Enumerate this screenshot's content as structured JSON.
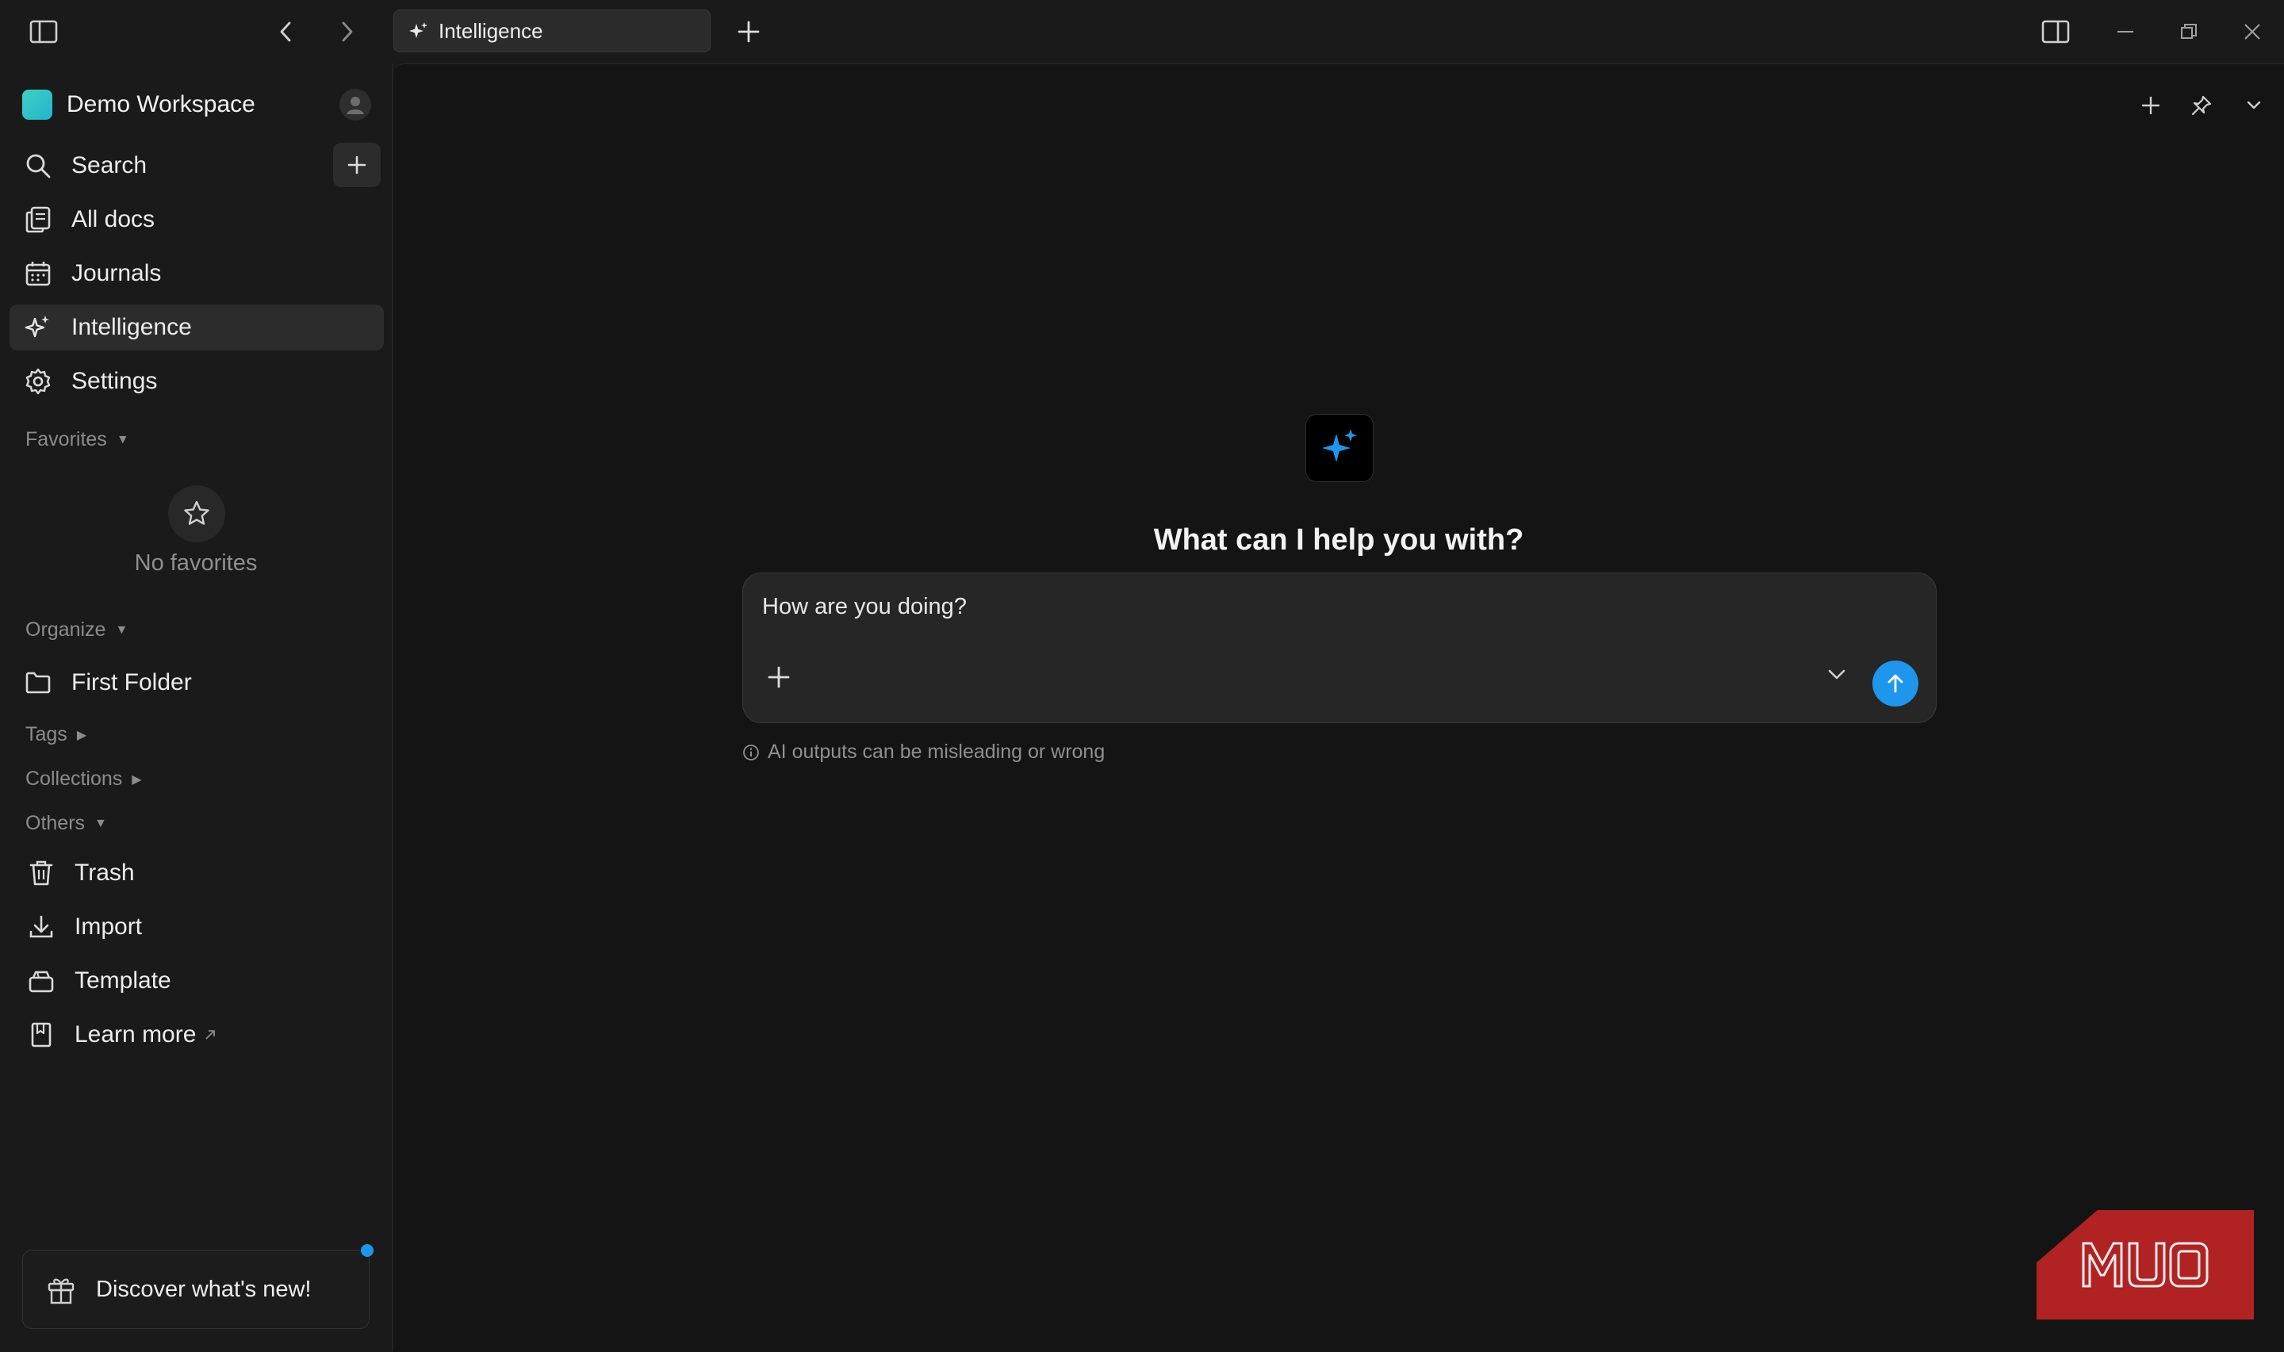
{
  "tab": {
    "label": "Intelligence"
  },
  "workspace": {
    "name": "Demo Workspace"
  },
  "sidebar": {
    "items": [
      {
        "label": "Search"
      },
      {
        "label": "All docs"
      },
      {
        "label": "Journals"
      },
      {
        "label": "Intelligence"
      },
      {
        "label": "Settings"
      }
    ],
    "favorites": {
      "header": "Favorites",
      "empty_text": "No favorites"
    },
    "organize": {
      "header": "Organize",
      "items": [
        {
          "label": "First Folder"
        }
      ]
    },
    "tags_header": "Tags",
    "collections_header": "Collections",
    "others": {
      "header": "Others",
      "items": [
        {
          "label": "Trash"
        },
        {
          "label": "Import"
        },
        {
          "label": "Template"
        },
        {
          "label": "Learn more"
        }
      ]
    },
    "discover": {
      "label": "Discover what's new!"
    }
  },
  "main": {
    "heading": "What can I help you with?",
    "composer_value": "How are you doing?",
    "disclaimer": "AI outputs can be misleading or wrong"
  },
  "watermark": {
    "text": "MUO"
  },
  "colors": {
    "accent": "#1e96eb",
    "workspace_logo": "#2fc4c8",
    "watermark": "#b12222"
  }
}
